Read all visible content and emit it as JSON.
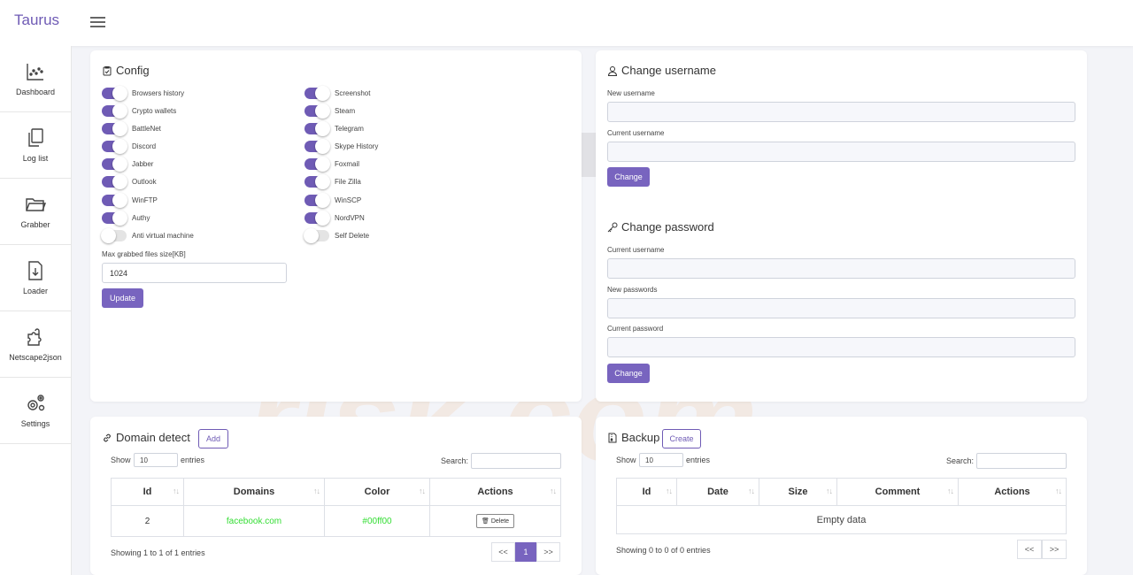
{
  "app": {
    "brand": "Taurus"
  },
  "sidebar": {
    "items": [
      {
        "label": "Dashboard",
        "icon": "chart-icon"
      },
      {
        "label": "Log list",
        "icon": "copy-icon"
      },
      {
        "label": "Grabber",
        "icon": "folder-icon"
      },
      {
        "label": "Loader",
        "icon": "download-file-icon"
      },
      {
        "label": "Netscape2json",
        "icon": "puzzle-icon"
      },
      {
        "label": "Settings",
        "icon": "gears-icon"
      }
    ]
  },
  "config": {
    "title": "Config",
    "left": [
      {
        "label": "Browsers history",
        "on": true
      },
      {
        "label": "Crypto wallets",
        "on": true
      },
      {
        "label": "BattleNet",
        "on": true
      },
      {
        "label": "Discord",
        "on": true
      },
      {
        "label": "Jabber",
        "on": true
      },
      {
        "label": "Outlook",
        "on": true
      },
      {
        "label": "WinFTP",
        "on": true
      },
      {
        "label": "Authy",
        "on": true
      },
      {
        "label": "Anti virtual machine",
        "on": false
      }
    ],
    "right": [
      {
        "label": "Screenshot",
        "on": true
      },
      {
        "label": "Steam",
        "on": true
      },
      {
        "label": "Telegram",
        "on": true
      },
      {
        "label": "Skype History",
        "on": true
      },
      {
        "label": "Foxmail",
        "on": true
      },
      {
        "label": "File Zilla",
        "on": true
      },
      {
        "label": "WinSCP",
        "on": true
      },
      {
        "label": "NordVPN",
        "on": true
      },
      {
        "label": "Self Delete",
        "on": false
      }
    ],
    "max_size_label": "Max grabbed files size[KB]",
    "max_size_value": "1024",
    "update_label": "Update"
  },
  "change_username": {
    "title": "Change username",
    "new_label": "New username",
    "current_label": "Current username",
    "button": "Change"
  },
  "change_password": {
    "title": "Change password",
    "current_label": "Current username",
    "new_label": "New passwords",
    "password_label": "Current password",
    "button": "Change"
  },
  "domain_detect": {
    "title": "Domain detect",
    "add_label": "Add",
    "show_label": "Show",
    "entries_value": "10",
    "entries_label": "entries",
    "search_label": "Search:",
    "columns": [
      "Id",
      "Domains",
      "Color",
      "Actions"
    ],
    "rows": [
      {
        "id": "2",
        "domain": "facebook.com",
        "color": "#00ff00",
        "action": "Delete"
      }
    ],
    "info": "Showing 1 to 1 of 1 entries",
    "pager": {
      "prev": "<<",
      "page": "1",
      "next": ">>"
    }
  },
  "backup": {
    "title": "Backup",
    "create_label": "Create",
    "show_label": "Show",
    "entries_value": "10",
    "entries_label": "entries",
    "search_label": "Search:",
    "columns": [
      "Id",
      "Date",
      "Size",
      "Comment",
      "Actions"
    ],
    "empty": "Empty data",
    "info": "Showing 0 to 0 of 0 entries",
    "pager": {
      "prev": "<<",
      "next": ">>"
    }
  },
  "colors": {
    "accent": "#7864bf",
    "brand": "#6f5bb5",
    "domain_color": "#33dd33"
  }
}
